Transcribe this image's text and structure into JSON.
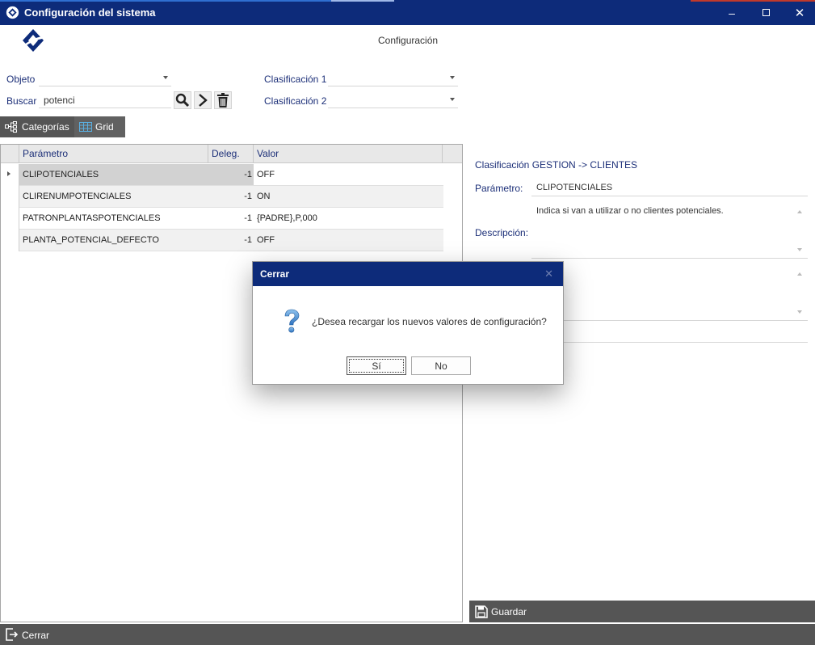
{
  "window": {
    "title": "Configuración del sistema",
    "minimize_icon": "minimize-icon",
    "maximize_icon": "maximize-icon",
    "close_icon": "close-icon"
  },
  "heading": "Configuración",
  "filters": {
    "objeto_label": "Objeto",
    "objeto_value": "",
    "buscar_label": "Buscar",
    "buscar_value": "potenci",
    "clasificacion1_label": "Clasificación 1",
    "clasificacion1_value": "",
    "clasificacion2_label": "Clasificación 2",
    "clasificacion2_value": ""
  },
  "tabs": [
    {
      "label": "Categorías",
      "icon": "tree-icon",
      "active": false
    },
    {
      "label": "Grid",
      "icon": "grid-icon",
      "active": true
    }
  ],
  "grid": {
    "columns": [
      "Parámetro",
      "Deleg.",
      "Valor"
    ],
    "rows": [
      {
        "parametro": "CLIPOTENCIALES",
        "deleg": "-1",
        "valor": "OFF"
      },
      {
        "parametro": "CLIRENUMPOTENCIALES",
        "deleg": "-1",
        "valor": "ON"
      },
      {
        "parametro": "PATRONPLANTASPOTENCIALES",
        "deleg": "-1",
        "valor": "{PADRE},P,000"
      },
      {
        "parametro": "PLANTA_POTENCIAL_DEFECTO",
        "deleg": "-1",
        "valor": "OFF"
      }
    ]
  },
  "detail": {
    "clasificacion": "Clasificación GESTION -> CLIENTES",
    "parametro_label": "Parámetro:",
    "parametro_value": "CLIPOTENCIALES",
    "descripcion_label": "Descripción:",
    "descripcion_value": "Indica si van a utilizar o no clientes potenciales."
  },
  "save_label": "Guardar",
  "close_label": "Cerrar",
  "dialog": {
    "title": "Cerrar",
    "message": "¿Desea recargar los nuevos valores de configuración?",
    "yes_label": "Sí",
    "no_label": "No"
  },
  "colors": {
    "titlebar": "#0d2b7a",
    "label_blue": "#1c2f78",
    "toolbar_gray": "#555555"
  }
}
